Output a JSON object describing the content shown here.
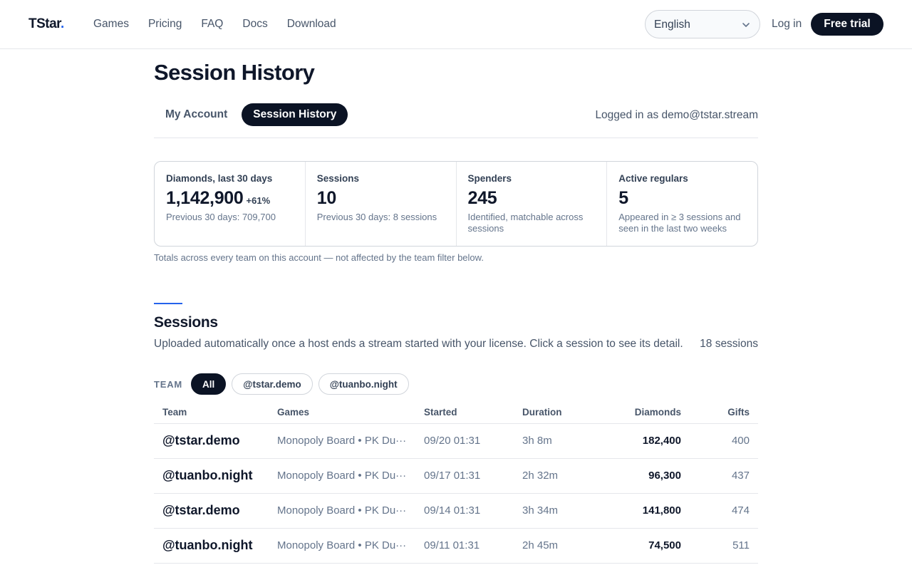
{
  "nav": {
    "logo": "TStar",
    "logo_dot": ".",
    "links": [
      "Games",
      "Pricing",
      "FAQ",
      "Docs",
      "Download"
    ],
    "language": "English",
    "login": "Log in",
    "trial": "Free trial"
  },
  "page": {
    "title": "Session History",
    "tabs": [
      "My Account",
      "Session History"
    ],
    "active_tab": "Session History",
    "logged_in": "Logged in as demo@tstar.stream"
  },
  "stats": [
    {
      "label": "Diamonds, last 30 days",
      "value": "1,142,900",
      "delta": "+61%",
      "sub": "Previous 30 days: 709,700"
    },
    {
      "label": "Sessions",
      "value": "10",
      "sub": "Previous 30 days: 8 sessions"
    },
    {
      "label": "Spenders",
      "value": "245",
      "sub": "Identified, matchable across sessions"
    },
    {
      "label": "Active regulars",
      "value": "5",
      "sub": "Appeared in ≥ 3 sessions and seen in the last two weeks"
    }
  ],
  "stats_note": "Totals across every team on this account — not affected by the team filter below.",
  "sessions": {
    "title": "Sessions",
    "description": "Uploaded automatically once a host ends a stream started with your license. Click a session to see its detail.",
    "count": "18 sessions",
    "filter_label": "TEAM",
    "filters": [
      "All",
      "@tstar.demo",
      "@tuanbo.night"
    ],
    "active_filter": "All",
    "columns": [
      "Team",
      "Games",
      "Started",
      "Duration",
      "Diamonds",
      "Gifts"
    ],
    "rows": [
      {
        "team": "@tstar.demo",
        "games": "Monopoly Board • PK Du···",
        "started": "09/20 01:31",
        "duration": "3h 8m",
        "diamonds": "182,400",
        "gifts": "400"
      },
      {
        "team": "@tuanbo.night",
        "games": "Monopoly Board • PK Du···",
        "started": "09/17 01:31",
        "duration": "2h 32m",
        "diamonds": "96,300",
        "gifts": "437"
      },
      {
        "team": "@tstar.demo",
        "games": "Monopoly Board • PK Du···",
        "started": "09/14 01:31",
        "duration": "3h 34m",
        "diamonds": "141,800",
        "gifts": "474"
      },
      {
        "team": "@tuanbo.night",
        "games": "Monopoly Board • PK Du···",
        "started": "09/11 01:31",
        "duration": "2h 45m",
        "diamonds": "74,500",
        "gifts": "511"
      }
    ]
  },
  "colors": {
    "primary": "#0b1324",
    "accent": "#2563eb",
    "border": "#e5e7eb",
    "muted": "#64748b"
  }
}
